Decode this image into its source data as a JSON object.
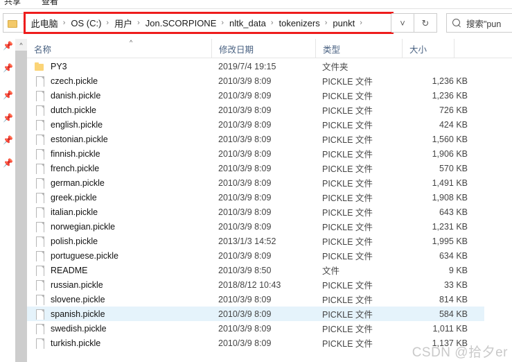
{
  "ribbon": {
    "tabs": [
      {
        "label": "共享"
      },
      {
        "label": "查看"
      }
    ]
  },
  "address_bar": {
    "breadcrumbs": [
      {
        "label": "此电脑"
      },
      {
        "label": "OS (C:)"
      },
      {
        "label": "用户"
      },
      {
        "label": "Jon.SCORPIONE"
      },
      {
        "label": "nltk_data"
      },
      {
        "label": "tokenizers"
      },
      {
        "label": "punkt"
      }
    ],
    "separator": "›",
    "history_icon": "chevron-down-icon",
    "refresh_icon": "refresh-icon",
    "highlight_color": "#ee1c1c"
  },
  "search": {
    "placeholder": "搜索\"punkt\"",
    "display_text": "搜索\"pun",
    "icon": "search-icon"
  },
  "nav_rail": {
    "pins": [
      {
        "icon": "pin-icon"
      },
      {
        "icon": "pin-icon"
      },
      {
        "icon": "pin-icon"
      },
      {
        "icon": "pin-icon"
      },
      {
        "icon": "pin-icon"
      },
      {
        "icon": "pin-icon"
      }
    ]
  },
  "scrollbar": {
    "up_arrow": "chevron-up-icon"
  },
  "columns": {
    "name": "名称",
    "date": "修改日期",
    "type": "类型",
    "size": "大小",
    "sort_indicator": "^"
  },
  "files": [
    {
      "name": "PY3",
      "date": "2019/7/4 19:15",
      "type": "文件夹",
      "size": "",
      "icon": "folder-icon",
      "selected": false
    },
    {
      "name": "czech.pickle",
      "date": "2010/3/9 8:09",
      "type": "PICKLE 文件",
      "size": "1,236 KB",
      "icon": "file-icon",
      "selected": false
    },
    {
      "name": "danish.pickle",
      "date": "2010/3/9 8:09",
      "type": "PICKLE 文件",
      "size": "1,236 KB",
      "icon": "file-icon",
      "selected": false
    },
    {
      "name": "dutch.pickle",
      "date": "2010/3/9 8:09",
      "type": "PICKLE 文件",
      "size": "726 KB",
      "icon": "file-icon",
      "selected": false
    },
    {
      "name": "english.pickle",
      "date": "2010/3/9 8:09",
      "type": "PICKLE 文件",
      "size": "424 KB",
      "icon": "file-icon",
      "selected": false
    },
    {
      "name": "estonian.pickle",
      "date": "2010/3/9 8:09",
      "type": "PICKLE 文件",
      "size": "1,560 KB",
      "icon": "file-icon",
      "selected": false
    },
    {
      "name": "finnish.pickle",
      "date": "2010/3/9 8:09",
      "type": "PICKLE 文件",
      "size": "1,906 KB",
      "icon": "file-icon",
      "selected": false
    },
    {
      "name": "french.pickle",
      "date": "2010/3/9 8:09",
      "type": "PICKLE 文件",
      "size": "570 KB",
      "icon": "file-icon",
      "selected": false
    },
    {
      "name": "german.pickle",
      "date": "2010/3/9 8:09",
      "type": "PICKLE 文件",
      "size": "1,491 KB",
      "icon": "file-icon",
      "selected": false
    },
    {
      "name": "greek.pickle",
      "date": "2010/3/9 8:09",
      "type": "PICKLE 文件",
      "size": "1,908 KB",
      "icon": "file-icon",
      "selected": false
    },
    {
      "name": "italian.pickle",
      "date": "2010/3/9 8:09",
      "type": "PICKLE 文件",
      "size": "643 KB",
      "icon": "file-icon",
      "selected": false
    },
    {
      "name": "norwegian.pickle",
      "date": "2010/3/9 8:09",
      "type": "PICKLE 文件",
      "size": "1,231 KB",
      "icon": "file-icon",
      "selected": false
    },
    {
      "name": "polish.pickle",
      "date": "2013/1/3 14:52",
      "type": "PICKLE 文件",
      "size": "1,995 KB",
      "icon": "file-icon",
      "selected": false
    },
    {
      "name": "portuguese.pickle",
      "date": "2010/3/9 8:09",
      "type": "PICKLE 文件",
      "size": "634 KB",
      "icon": "file-icon",
      "selected": false
    },
    {
      "name": "README",
      "date": "2010/3/9 8:50",
      "type": "文件",
      "size": "9 KB",
      "icon": "file-icon",
      "selected": false
    },
    {
      "name": "russian.pickle",
      "date": "2018/8/12 10:43",
      "type": "PICKLE 文件",
      "size": "33 KB",
      "icon": "file-icon",
      "selected": false
    },
    {
      "name": "slovene.pickle",
      "date": "2010/3/9 8:09",
      "type": "PICKLE 文件",
      "size": "814 KB",
      "icon": "file-icon",
      "selected": false
    },
    {
      "name": "spanish.pickle",
      "date": "2010/3/9 8:09",
      "type": "PICKLE 文件",
      "size": "584 KB",
      "icon": "file-icon",
      "selected": true
    },
    {
      "name": "swedish.pickle",
      "date": "2010/3/9 8:09",
      "type": "PICKLE 文件",
      "size": "1,011 KB",
      "icon": "file-icon",
      "selected": false
    },
    {
      "name": "turkish.pickle",
      "date": "2010/3/9 8:09",
      "type": "PICKLE 文件",
      "size": "1,137 KB",
      "icon": "file-icon",
      "selected": false
    }
  ],
  "watermark": {
    "text": "CSDN @拾夕er"
  }
}
